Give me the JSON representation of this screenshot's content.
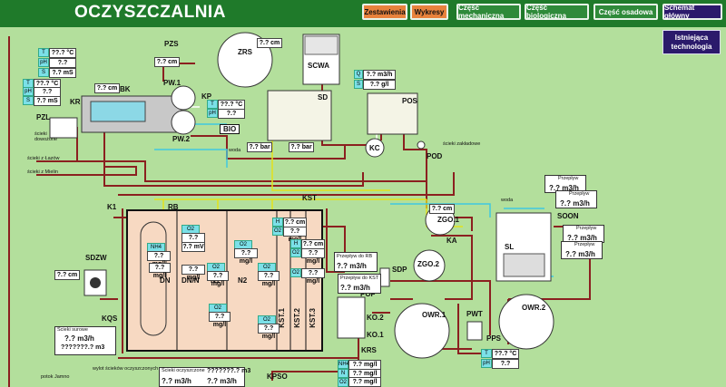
{
  "header": {
    "title": "OCZYSZCZALNIA",
    "nav": [
      "Zestawienia",
      "Wykresy",
      "Część mechaniczna",
      "Część biologiczna",
      "Część osadowa",
      "Schemat główny"
    ],
    "side_button": "Istniejąca technologia"
  },
  "labels": {
    "pzs": "PZS",
    "zrs": "ZRS",
    "scwa": "SCWA",
    "bk": "BK",
    "kr": "KR",
    "pzl": "PZL",
    "pw1": "PW.1",
    "pw2": "PW.2",
    "kp": "KP",
    "bio": "BIO",
    "sd": "SD",
    "pos": "POS",
    "kc": "KC",
    "pod": "POD",
    "k1": "K1",
    "rb": "RB",
    "kst": "KST",
    "zgo1": "ZGO.1",
    "ka": "KA",
    "zgo2": "ZGO.2",
    "sl": "SL",
    "soon": "SOON",
    "sdzw": "SDZW",
    "kqs": "KQS",
    "dn": "DN",
    "dnn": "DN/N",
    "n1": "N1",
    "n2": "N2",
    "kst1": "KST.1",
    "kst2": "KST.2",
    "kst3": "KST.3",
    "sdp": "SDP",
    "pof": "POF",
    "ko1": "KO.1",
    "ko2": "KO.2",
    "owr1": "OWR.1",
    "owr2": "OWR.2",
    "pwt": "PWT",
    "pps": "PPS",
    "krs": "KRS",
    "kpso": "KPSO",
    "woda": "woda",
    "woda2": "woda"
  },
  "small_text": {
    "scieki_dowozone": "ścieki dowożone",
    "scieki_lazow": "ścieki z Łazów",
    "scieki_mielin": "ścieki z Mielin",
    "scieki_zakladowe": "ścieki zakładowe",
    "wylot": "wylot ścieków oczyszczonych",
    "potok": "potok Jamno",
    "przeplyw_rb": "Przepływ do RB",
    "przeplyw_kst": "Przepływ do KST",
    "przeplyw1": "Przepływ",
    "przeplyw2": "Przepływ",
    "przeplyw3": "Przepływ",
    "przeplyw4": "Przepływ",
    "scieki_surowe": "Ścieki surowe",
    "scieki_oczyszczone": "Ścieki oczyszczone"
  },
  "readouts": {
    "pzs_cm": "?.? cm",
    "zrs_cm": "?.? cm",
    "bk_cm": "?.? cm",
    "scwa_m3h": "?.? m3/h",
    "scwa_gl": "?.? g/l",
    "kr_t": "??.? °C",
    "kr_ph": "?.?",
    "kr_ms": "?.? mS",
    "pzl_t": "??.? °C",
    "pzl_ph": "?.?",
    "pzl_ms": "?.? mS",
    "kp_t": "??.? °C",
    "kp_ph": "?.?",
    "sd_bar1": "?.? bar",
    "sd_bar2": "?.? bar",
    "kc_cm": "?.? cm",
    "zgo_cm": "?.? cm",
    "sdzw_cm": "?.? cm",
    "kst_cm1": "?.? cm",
    "kst_mgl1": "?.? mg/l",
    "kst_cm2": "?.? cm",
    "kst_mgl2": "?.? mg/l",
    "kst_mgl3": "?.? mg/l",
    "flow_rb": "?.? m3/h",
    "flow_kst": "?.? m3/h",
    "flow1": "?.? m3/h",
    "flow2": "?.? m3/h",
    "flow3": "?.? m3/h",
    "flow4": "?.? m3/h",
    "surowe_m3h": "?.? m3/h",
    "surowe_total": "???????.? m3",
    "oczysz_total": "???????.? m3",
    "oczysz_m3h": "?.? m3/h",
    "krs_mgl1": "?.? mg/l",
    "krs_mgl2": "?.? mg/l",
    "krs_mgl3": "?.? mg/l",
    "pps_t": "??.? °C",
    "pps_ph": "?.?",
    "rb_mgl1": "?.? mg/l",
    "rb_mgl2": "?.? mg/l",
    "rb_mv": "?.? mV",
    "rb_mgl3": "?.? mg/l",
    "rb_mgl4": "?.? mg/l",
    "rb_mgl5": "?.? mg/l",
    "rb_mgl6": "?.? mg/l",
    "rb_mgl7": "?.? mg/l",
    "rb_mgl8": "?.? mg/l",
    "rb_mgl9": "?.? mg/l"
  },
  "tags": {
    "t": "T",
    "ph": "pH",
    "s": "S",
    "q": "Q",
    "h": "H",
    "o2": "O2",
    "n": "N",
    "nh4": "NH4",
    "kst_q": "Q"
  },
  "colors": {
    "background": "#b3df9c",
    "header": "#1f7a2a",
    "pipe_red": "#8b2020",
    "pipe_yellow": "#e3e21b",
    "pipe_cyan": "#3fc9e0",
    "pipe_white": "#ffffff",
    "tank_fill": "#f7d9c2",
    "nav_orange": "#e8823c",
    "nav_purple": "#2b1a6b"
  }
}
